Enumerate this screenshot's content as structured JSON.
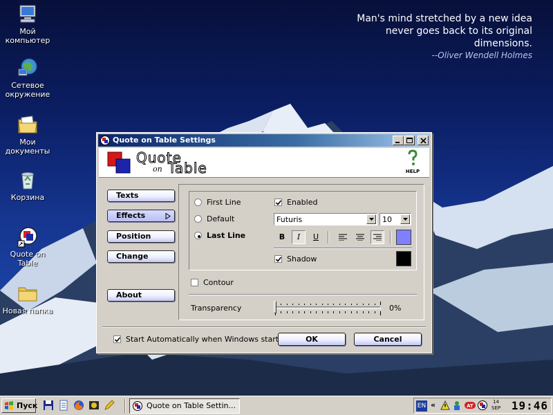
{
  "quote": {
    "lines": [
      "Man's mind stretched by a new idea",
      "never goes back to its original",
      "dimensions."
    ],
    "author": "--Oliver Wendell Holmes"
  },
  "desktop_icons": [
    {
      "label": "Мой компьютер",
      "icon": "my-computer-icon"
    },
    {
      "label": "Сетевое окружение",
      "icon": "network-places-icon"
    },
    {
      "label": "Мои документы",
      "icon": "my-documents-icon"
    },
    {
      "label": "Корзина",
      "icon": "recycle-bin-icon"
    },
    {
      "label": "Quote on Table",
      "icon": "quote-on-table-shortcut-icon"
    },
    {
      "label": "Новая папка",
      "icon": "folder-icon"
    }
  ],
  "dialog": {
    "title": "Quote on Table Settings",
    "logo": {
      "word1": "Quote",
      "word2": "on",
      "word3": "Table"
    },
    "help_label": "HELP",
    "nav": {
      "texts": "Texts",
      "effects": "Effects",
      "position": "Position",
      "change": "Change",
      "about": "About"
    },
    "lines": {
      "first": "First Line",
      "default": "Default",
      "last": "Last Line",
      "selected": "Last Line"
    },
    "enabled_label": "Enabled",
    "enabled_checked": true,
    "font_name": "Futuris",
    "font_size": "10",
    "format_buttons": {
      "bold": "B",
      "italic": "I",
      "underline": "U"
    },
    "text_color": "#8080ff",
    "shadow_label": "Shadow",
    "shadow_checked": true,
    "shadow_color": "#000000",
    "contour_label": "Contour",
    "contour_checked": false,
    "transparency_label": "Transparency",
    "transparency_value": "0%",
    "start_auto_label": "Start Automatically when Windows starts",
    "start_auto_checked": true,
    "ok_label": "OK",
    "cancel_label": "Cancel"
  },
  "taskbar": {
    "start_label": "Пуск",
    "task_label": "Quote on Table Settin...",
    "lang": "EN",
    "date_day": "14",
    "date_month": "SEP",
    "time": "19:46"
  }
}
